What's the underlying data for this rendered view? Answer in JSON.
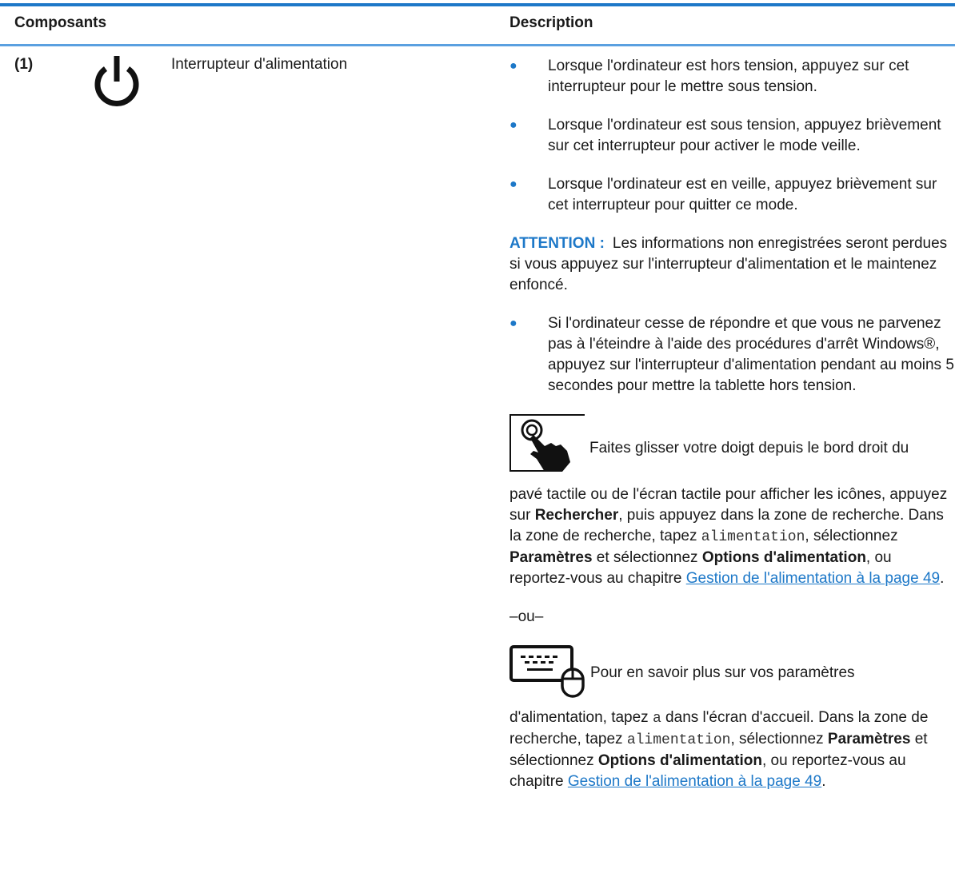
{
  "header": {
    "components": "Composants",
    "description": "Description"
  },
  "row": {
    "number": "(1)",
    "icon": "power-icon",
    "name": "Interrupteur d'alimentation"
  },
  "bullets": [
    "Lorsque l'ordinateur est hors tension, appuyez sur cet interrupteur pour le mettre sous tension.",
    "Lorsque l'ordinateur est sous tension, appuyez brièvement sur cet interrupteur pour activer le mode veille.",
    "Lorsque l'ordinateur est en veille, appuyez brièvement sur cet interrupteur pour quitter ce mode."
  ],
  "caution": {
    "label": "ATTENTION :",
    "text": "Les informations non enregistrées seront perdues si vous appuyez sur l'interrupteur d'alimentation et le maintenez enfoncé."
  },
  "bullet_4": "Si l'ordinateur cesse de répondre et que vous ne parvenez pas à l'éteindre à l'aide des procédures d'arrêt Windows®, appuyez sur l'interrupteur d'alimentation pendant au moins 5 secondes pour mettre la tablette hors tension.",
  "touch": {
    "icon": "touch-gesture-icon",
    "line1": "Faites glisser votre doigt depuis le bord droit du",
    "p1": "pavé tactile ou de l'écran tactile pour afficher les icônes, appuyez sur ",
    "b1": "Rechercher",
    "p2": ", puis appuyez dans la zone de recherche. Dans la zone de recherche, tapez ",
    "code": "alimentation",
    "p3": ", sélectionnez ",
    "b2": "Paramètres",
    "p4": " et sélectionnez ",
    "b3": "Options d'alimentation",
    "p5": ", ou reportez-vous au chapitre ",
    "link": "Gestion de l'alimentation à la page 49",
    "p6": "."
  },
  "or": "–ou–",
  "keyboard": {
    "icon": "keyboard-mouse-icon",
    "line1": "Pour en savoir plus sur vos paramètres",
    "p1": "d'alimentation, tapez ",
    "code1": "a",
    "p2": " dans l'écran d'accueil. Dans la zone de recherche, tapez ",
    "code2": "alimentation",
    "p3": ", sélectionnez ",
    "b1": "Paramètres",
    "p4": " et sélectionnez ",
    "b2": "Options d'alimentation",
    "p5": ", ou reportez-vous au chapitre ",
    "link": "Gestion de l'alimentation à la page 49",
    "p6": "."
  },
  "colors": {
    "accent": "#1d78c8",
    "rule_light": "#5aa0e0",
    "text": "#1a1a1a"
  }
}
